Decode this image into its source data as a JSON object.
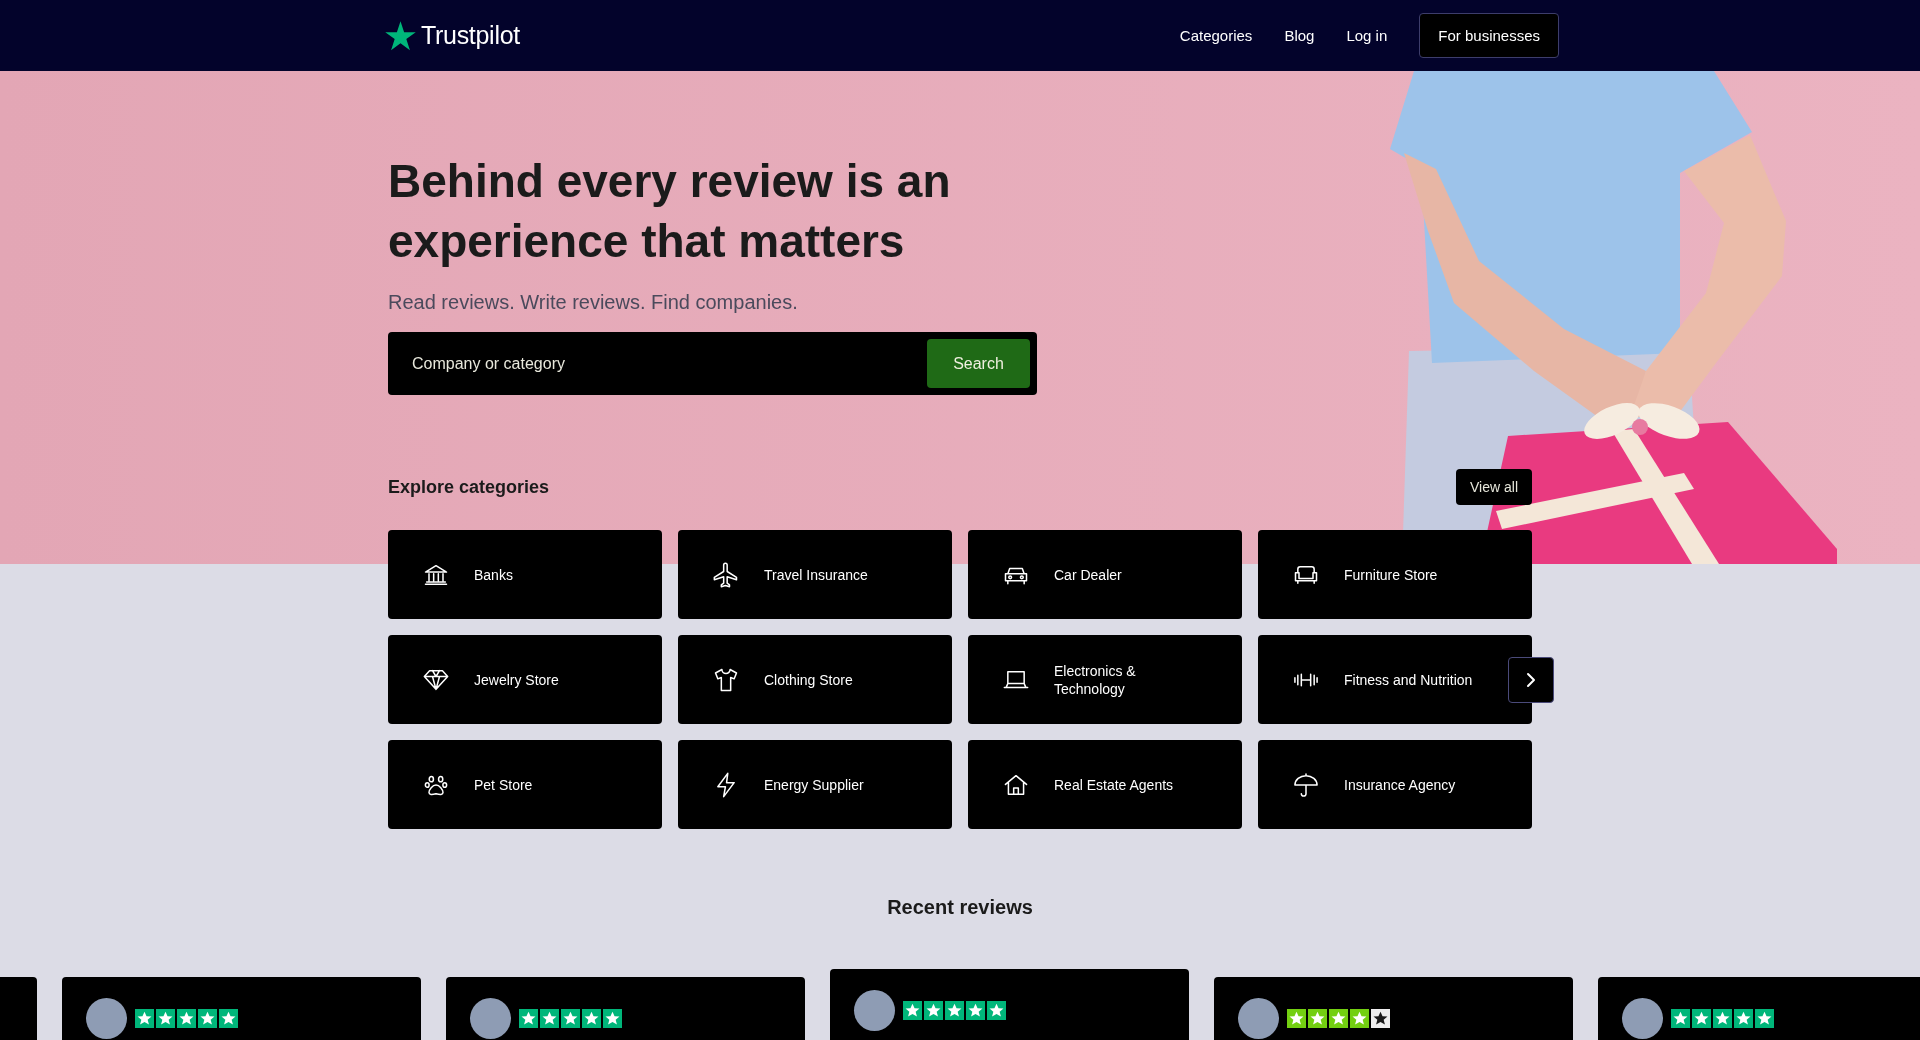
{
  "header": {
    "logo": "Trustpilot",
    "nav": [
      {
        "label": "Categories"
      },
      {
        "label": "Blog"
      },
      {
        "label": "Log in"
      }
    ],
    "cta": "For businesses"
  },
  "hero": {
    "title": "Behind every review is an experience that matters",
    "subtitle": "Read reviews. Write reviews. Find companies.",
    "search": {
      "placeholder": "Company or category",
      "button": "Search"
    }
  },
  "categories": {
    "heading": "Explore categories",
    "view_all": "View all",
    "items": [
      {
        "label": "Banks"
      },
      {
        "label": "Travel Insurance"
      },
      {
        "label": "Car Dealer"
      },
      {
        "label": "Furniture Store"
      },
      {
        "label": "Jewelry Store"
      },
      {
        "label": "Clothing Store"
      },
      {
        "label": "Electronics & Technology"
      },
      {
        "label": "Fitness and Nutrition"
      },
      {
        "label": "Pet Store"
      },
      {
        "label": "Energy Supplier"
      },
      {
        "label": "Real Estate Agents"
      },
      {
        "label": "Insurance Agency"
      }
    ]
  },
  "recent_reviews": {
    "heading": "Recent reviews",
    "cards": [
      {
        "kind": "clipped",
        "selected": false
      },
      {
        "kind": "rating",
        "stars": 5,
        "selected": false
      },
      {
        "kind": "rating",
        "stars": 5,
        "selected": false
      },
      {
        "kind": "rating",
        "stars": 5,
        "selected": true
      },
      {
        "kind": "rating",
        "stars": 4,
        "selected": false
      },
      {
        "kind": "rating",
        "stars": 5,
        "selected": false
      }
    ]
  }
}
